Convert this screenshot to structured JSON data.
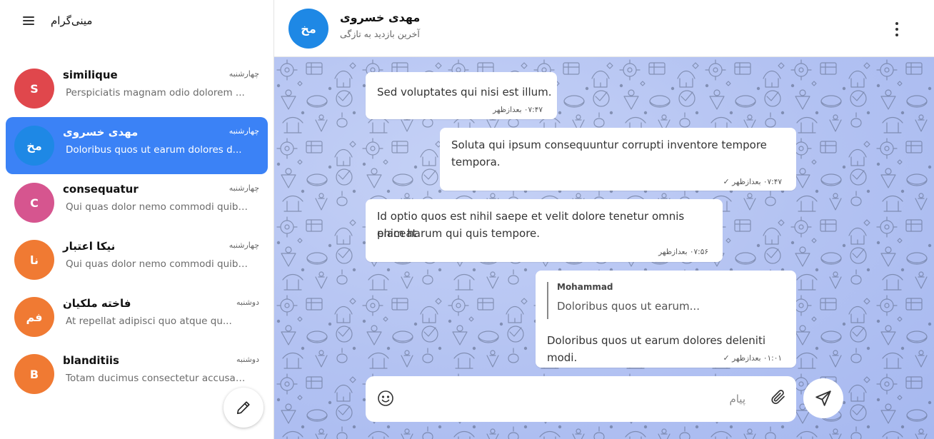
{
  "app": {
    "title": "مینی‌گرام"
  },
  "sidebar": {
    "chats": [
      {
        "name": "similique",
        "date": "چهارشنبه",
        "preview": "Perspiciatis magnam odio dolorem ...",
        "initials": "S",
        "color": "#e0474c"
      },
      {
        "name": "مهدی خسروی",
        "date": "چهارشنبه",
        "preview": "Doloribus quos ut earum dolores d...",
        "initials": "مخ",
        "color": "#1e88e5"
      },
      {
        "name": "consequatur",
        "date": "چهارشنبه",
        "preview": "Qui quas dolor nemo commodi quibu...",
        "initials": "C",
        "color": "#d6558f"
      },
      {
        "name": "نیکا اعتبار",
        "date": "چهارشنبه",
        "preview": "Qui quas dolor nemo commodi quibu...",
        "initials": "نا",
        "color": "#f07a33"
      },
      {
        "name": "فاخته ملکیان",
        "date": "دوشنبه",
        "preview": "At repellat adipisci quo atque qu...",
        "initials": "فم",
        "color": "#f07a33"
      },
      {
        "name": "blanditiis",
        "date": "دوشنبه",
        "preview": "Totam ducimus consectetur accusam...",
        "initials": "B",
        "color": "#f07a33"
      }
    ]
  },
  "header": {
    "name": "مهدی خسروی",
    "initials": "مخ",
    "status": "آخرین بازدید به تازگی"
  },
  "messages": [
    {
      "text": "Sed voluptates qui nisi est illum.",
      "time": "۰۷:۴۷ بعدازظهر"
    },
    {
      "text1": "Soluta qui ipsum consequuntur corrupti inventore tempore",
      "text2": "tempora.",
      "time": "۰۷:۴۷ بعدازظهر",
      "check": "✓"
    },
    {
      "text1": "Id optio quos est nihil saepe et velit dolore tenetur omnis placeat",
      "text2": "enim harum qui quis tempore.",
      "time": "۰۷:۵۶ بعدازظهر"
    },
    {
      "reply_name": "Mohammad",
      "reply_text": "Doloribus quos ut earum...",
      "text": "Doloribus quos ut earum dolores deleniti modi.",
      "time": "۰۱:۰۱ بعدازظهر",
      "check": "✓"
    }
  ],
  "composer": {
    "placeholder": "پیام"
  },
  "icons": {
    "menu": "hamburger-icon",
    "compose": "pencil-icon",
    "more": "more-vert-icon",
    "emoji": "smiley-icon",
    "attach": "paperclip-icon",
    "send": "send-icon"
  },
  "colors": {
    "accent": "#3b82f6",
    "header_avatar": "#1e88e5"
  }
}
